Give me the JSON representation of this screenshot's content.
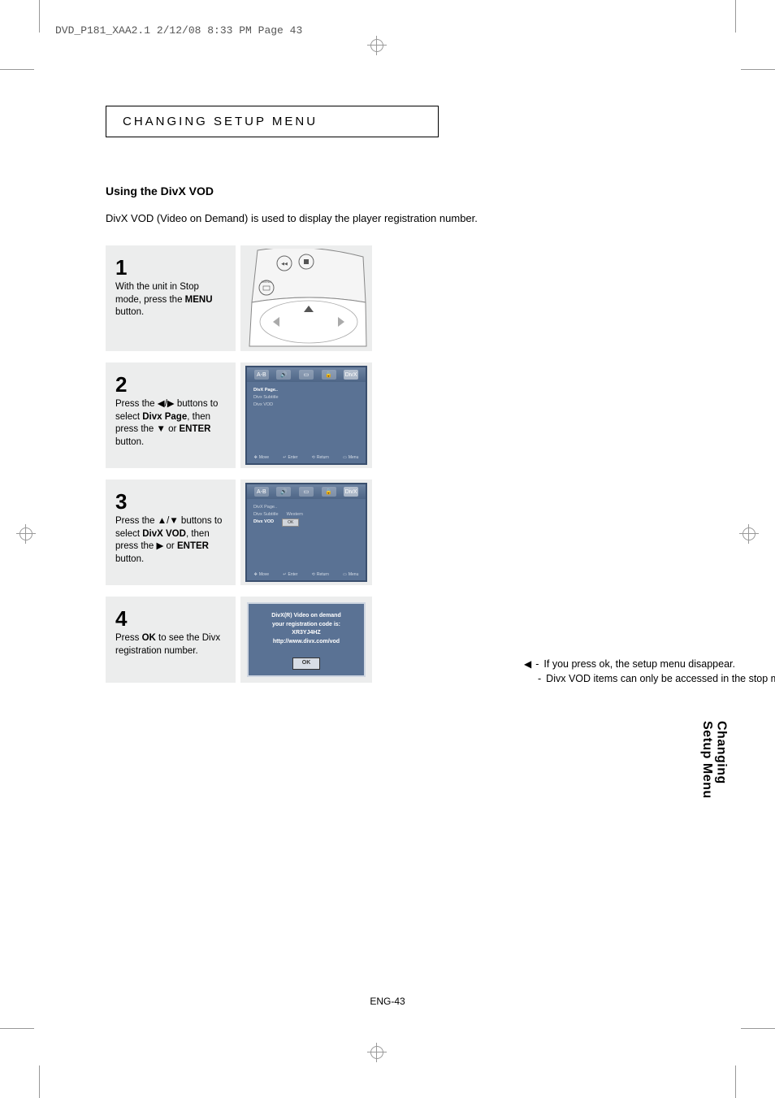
{
  "print_header": "DVD_P181_XAA2.1  2/12/08  8:33 PM  Page 43",
  "section_title": "CHANGING SETUP MENU",
  "using_title": "Using the DivX VOD",
  "intro": "DivX VOD (Video on Demand) is used to display the player registration number.",
  "steps": {
    "s1": {
      "num": "1",
      "desc_a": "With the unit in Stop mode, press the ",
      "bold": "MENU",
      "desc_b": " button."
    },
    "s2": {
      "num": "2",
      "desc_a": "Press the ◀/▶ buttons to select ",
      "bold1": "Divx Page",
      "mid": ", then press the ▼ or ",
      "bold2": "ENTER",
      "desc_b": " button."
    },
    "s3": {
      "num": "3",
      "desc_a": "Press the ▲/▼ buttons to select ",
      "bold1": "DivX VOD",
      "mid": ", then press the ▶ or ",
      "bold2": "ENTER",
      "desc_b": " button."
    },
    "s4": {
      "num": "4",
      "desc_a": "Press ",
      "bold": "OK",
      "desc_b": " to see the Divx registration number."
    }
  },
  "osd": {
    "items": {
      "divxpage": "DivX Page..",
      "subtitle": "Divx Subtitle",
      "vod": "Divx VOD",
      "western": "Western",
      "ok": "OK"
    },
    "footer": {
      "move": "Move",
      "enter": "Enter",
      "return": "Return",
      "menu": "Menu"
    },
    "topicons": {
      "ab": "A-B",
      "audio": "🔊",
      "lang": "▭",
      "lock": "🔒",
      "divx": "DivX"
    }
  },
  "dvod": {
    "line1": "DivX(R) Video on demand",
    "line2": "your registration  code is:",
    "code": "XR3YJ4HZ",
    "url": "http://www.divx.com/vod",
    "ok": "OK"
  },
  "notes": {
    "n1": "If you press ok, the setup menu disappear.",
    "n2": "Divx VOD items can only be accessed in the stop mode."
  },
  "side_tab": {
    "l1": "Changing",
    "l2": "Setup Menu"
  },
  "page_num": "ENG-43",
  "remote_label": "MENU"
}
